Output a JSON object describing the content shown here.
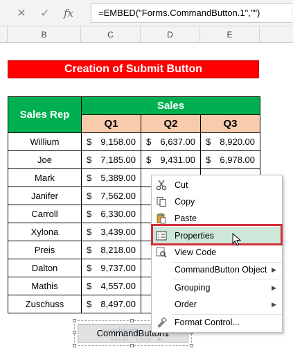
{
  "formula_bar": {
    "cancel_icon": "✕",
    "enter_icon": "✓",
    "fx_icon": "fx",
    "formula": "=EMBED(\"Forms.CommandButton.1\",\"\")"
  },
  "columns": [
    "B",
    "C",
    "D",
    "E"
  ],
  "title": "Creation of Submit Button",
  "table": {
    "rep_header": "Sales Rep",
    "sales_header": "Sales",
    "quarters": [
      "Q1",
      "Q2",
      "Q3"
    ],
    "currency": "$",
    "rows": [
      {
        "name": "Willium",
        "q1": "9,158.00",
        "q2": "6,637.00",
        "q3": "8,920.00"
      },
      {
        "name": "Joe",
        "q1": "7,185.00",
        "q2": "9,431.00",
        "q3": "6,978.00"
      },
      {
        "name": "Mark",
        "q1": "5,389.00",
        "q2": "",
        "q3": ""
      },
      {
        "name": "Janifer",
        "q1": "7,562.00",
        "q2": "",
        "q3": ""
      },
      {
        "name": "Carroll",
        "q1": "6,330.00",
        "q2": "",
        "q3": ""
      },
      {
        "name": "Xylona",
        "q1": "3,439.00",
        "q2": "",
        "q3": ""
      },
      {
        "name": "Preis",
        "q1": "8,218.00",
        "q2": "",
        "q3": ""
      },
      {
        "name": "Dalton",
        "q1": "9,737.00",
        "q2": "",
        "q3": ""
      },
      {
        "name": "Mathis",
        "q1": "4,557.00",
        "q2": "",
        "q3": ""
      },
      {
        "name": "Zuschuss",
        "q1": "8,497.00",
        "q2": "",
        "q3": ""
      }
    ]
  },
  "command_button": {
    "label": "CommandButton1"
  },
  "watermark": {
    "name": "exceldemy",
    "tagline": "EXCEL · DATA · BI"
  },
  "context_menu": {
    "cut": "Cut",
    "copy": "Copy",
    "paste": "Paste",
    "properties": "Properties",
    "view_code": "View Code",
    "commandbutton_object": "CommandButton Object",
    "grouping": "Grouping",
    "order": "Order",
    "format_control": "Format Control...",
    "submenu_arrow": "▶"
  },
  "colors": {
    "title_bg": "#ff0000",
    "header_green": "#00b050",
    "quarter_bg": "#f8cbad",
    "highlight": "#d32f3c"
  }
}
